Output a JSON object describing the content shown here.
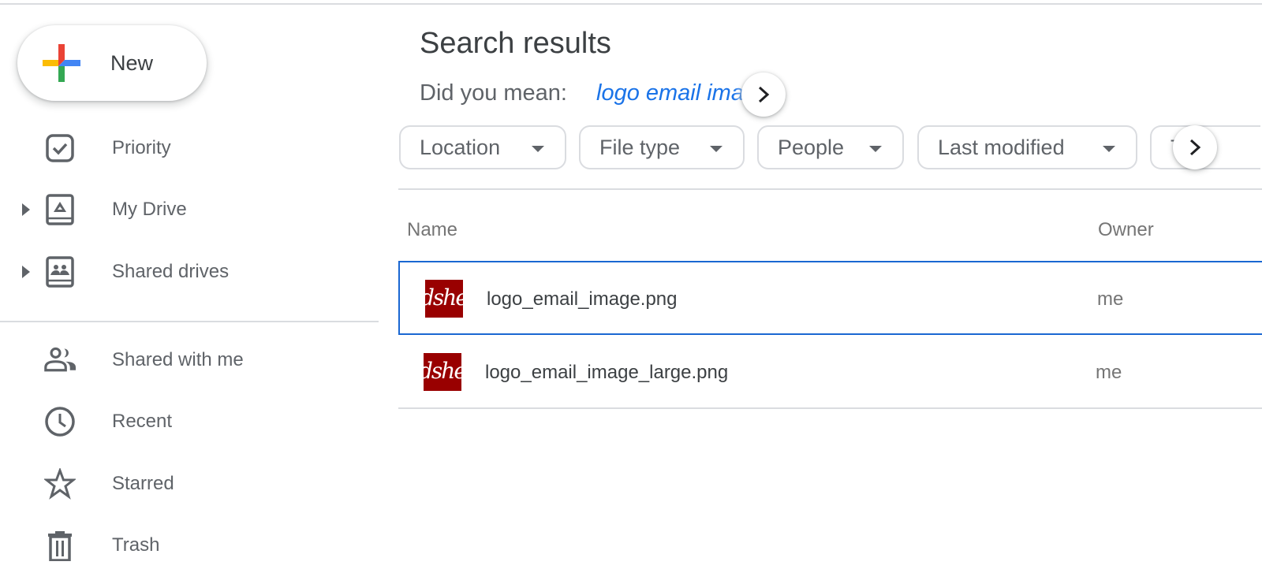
{
  "sidebar": {
    "new_button": {
      "label": "New",
      "icon": "google-plus-icon"
    },
    "items": [
      {
        "label": "Priority",
        "icon": "checkbox-icon",
        "expandable": false
      },
      {
        "label": "My Drive",
        "icon": "my-drive-icon",
        "expandable": true
      },
      {
        "label": "Shared drives",
        "icon": "shared-drives-icon",
        "expandable": true
      },
      {
        "label": "Shared with me",
        "icon": "people-icon",
        "expandable": false
      },
      {
        "label": "Recent",
        "icon": "clock-icon",
        "expandable": false
      },
      {
        "label": "Starred",
        "icon": "star-icon",
        "expandable": false
      },
      {
        "label": "Trash",
        "icon": "trash-icon",
        "expandable": false
      }
    ]
  },
  "main": {
    "title": "Search results",
    "did_you_mean": {
      "prefix": "Did you mean:",
      "suggestion": "logo email image"
    },
    "filters": [
      {
        "label": "Location"
      },
      {
        "label": "File type"
      },
      {
        "label": "People"
      },
      {
        "label": "Last modified"
      },
      {
        "label": "Title"
      }
    ],
    "columns": {
      "name": "Name",
      "owner": "Owner"
    },
    "files": [
      {
        "name": "logo_email_image.png",
        "owner": "me",
        "thumb_text": "dshee",
        "selected": true
      },
      {
        "name": "logo_email_image_large.png",
        "owner": "me",
        "thumb_text": "dshee",
        "selected": false
      }
    ]
  },
  "colors": {
    "accent": "#1a73e8",
    "selection_border": "#1a67d2",
    "thumb_bg": "#990000",
    "divider": "#dadce0",
    "icon_gray": "#5f6368"
  }
}
